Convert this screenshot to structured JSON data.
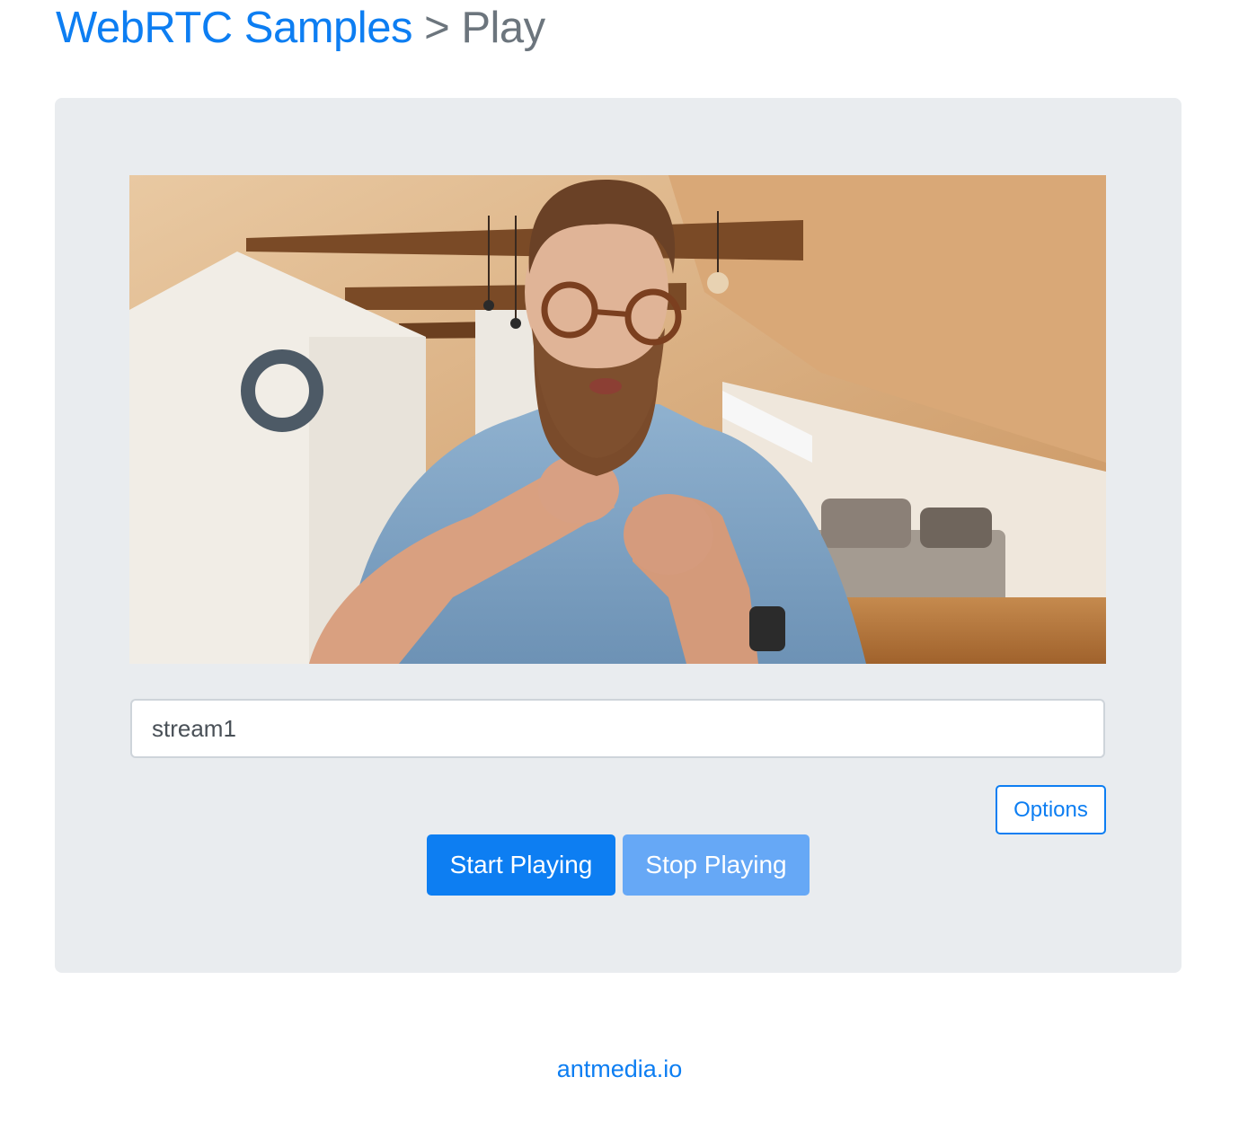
{
  "header": {
    "home_label": "WebRTC Samples",
    "separator": ">",
    "current_label": "Play"
  },
  "player": {
    "stream_id_value": "stream1",
    "options_label": "Options",
    "start_label": "Start Playing",
    "stop_label": "Stop Playing"
  },
  "footer": {
    "link_label": "antmedia.io"
  },
  "colors": {
    "accent": "#0d7ef2",
    "disabled_accent": "#66a8f6",
    "panel_bg": "#e9ecef",
    "muted_text": "#6c757d"
  }
}
